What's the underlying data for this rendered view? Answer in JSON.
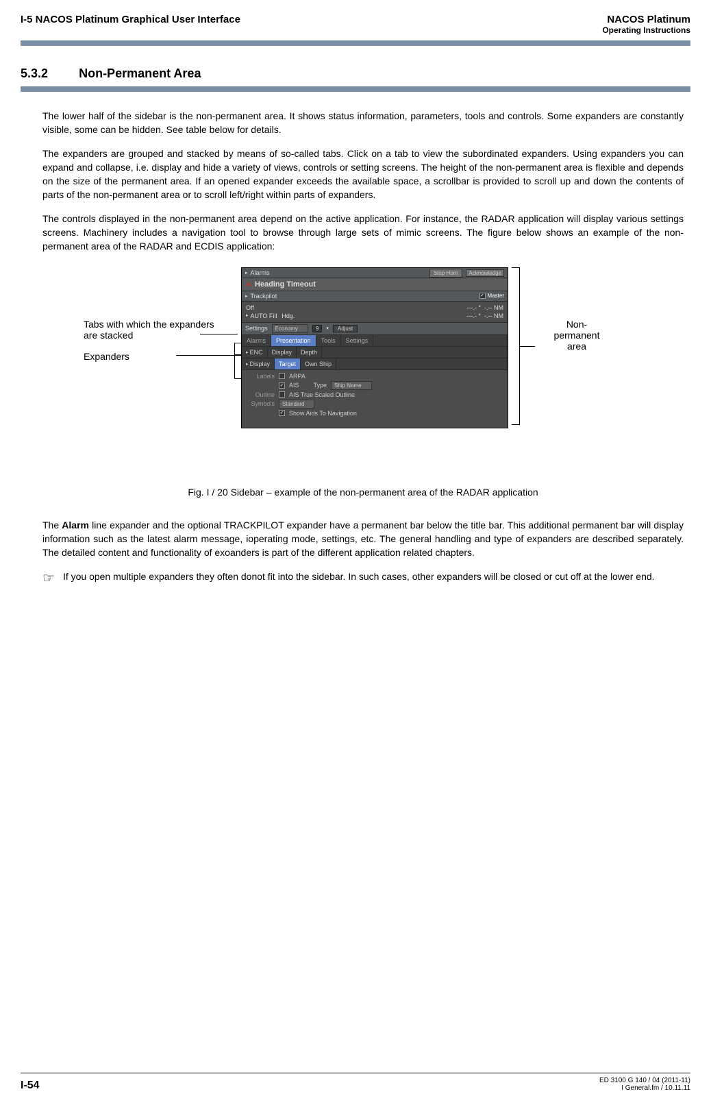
{
  "header": {
    "left": "I-5  NACOS Platinum Graphical User Interface",
    "right_title": "NACOS Platinum",
    "right_sub": "Operating Instructions"
  },
  "section": {
    "number": "5.3.2",
    "title": "Non-Permanent Area"
  },
  "paragraphs": {
    "p1": "The lower half of the sidebar is the non-permanent area. It shows status information, parameters, tools and controls. Some expanders are constantly visible, some can be hidden. See table below for details.",
    "p2": "The expanders are grouped and stacked by means of so-called tabs. Click on a tab to view the subordinated expanders. Using expanders you can expand and collapse, i.e. display and hide a variety of views, controls or setting screens. The height of the non-permanent area is flexible and depends on the size of the permanent area. If an opened expander exceeds the available space, a scrollbar is provided to scroll up and down the contents of parts of the non-permanent area or to scroll left/right within parts of expanders.",
    "p3": "The controls displayed in the non-permanent area depend on the active application. For instance, the RADAR application will display various settings screens. Machinery includes a navigation tool to browse through large sets of mimic screens. The figure below shows an example of the non-permanent area of the RADAR and ECDIS application:"
  },
  "annotations": {
    "tabs_label": "Tabs with which the expanders are stacked",
    "expanders_label": "Expanders",
    "nonperm_label_l1": "Non-",
    "nonperm_label_l2": "permanent",
    "nonperm_label_l3": "area"
  },
  "figure": {
    "alarm_label": "Alarms",
    "stop_horn": "Stop Horn",
    "ack": "Acknowledge",
    "heading": "Heading Timeout",
    "trackpilot": "Trackpilot",
    "master": "Master",
    "off": "Off",
    "autofill": "AUTO Fill",
    "hdg": "Hdg.",
    "dashes1": "---.-",
    "dashes2": "---.-",
    "deg": "°",
    "nm1": "-.-- NM",
    "nm2": "-.-- NM",
    "settings": "Settings",
    "economy": "Economy",
    "spin": "9",
    "adjust": "Adjust",
    "tabs": [
      "Alarms",
      "Presentation",
      "Tools",
      "Settings"
    ],
    "active_tab_index": 1,
    "expanders": [
      "ENC",
      "Display",
      "Depth"
    ],
    "expander_row2": [
      "Display",
      "Target",
      "Own Ship"
    ],
    "active_expander": "Target",
    "body_labels": "Labels",
    "body_outline": "Outline",
    "body_symbols": "Symbols",
    "arpa": "ARPA",
    "ais": "AIS",
    "type": "Type",
    "ship_name": "Ship Name",
    "true_scaled": "AIS True Scaled Outline",
    "standard": "Standard",
    "show_aids": "Show Aids To Navigation"
  },
  "caption": "Fig. I /  20    Sidebar – example of the non-permanent area of the RADAR application",
  "paragraph4_prefix": "The ",
  "paragraph4_bold": "Alarm",
  "paragraph4_rest": " line expander and the optional TRACKPILOT expander have a permanent bar below the title bar. This additional permanent bar will display information such as the latest alarm message, ioperating mode, settings, etc. The general handling and type of expanders are described separately. The detailed content and functionality of exoanders is part of the different application related chapters.",
  "note": {
    "icon": "☞",
    "text": "If you open multiple expanders they often donot fit into the sidebar. In such cases, other expanders will be closed or cut off at the lower end."
  },
  "footer": {
    "page": "I-54",
    "doc": "ED 3100 G 140 / 04 (2011-11)",
    "file": "I General.fm / 10.11.11"
  }
}
